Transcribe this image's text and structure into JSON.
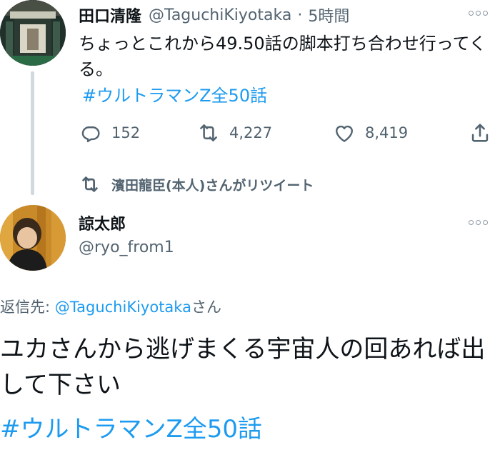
{
  "tweet1": {
    "author_name": "田口清隆",
    "author_handle": "@TaguchiKiyotaka",
    "separator": "·",
    "time": "5時間",
    "text": "ちょっとこれから49.50話の脚本打ち合わせ行ってくる。",
    "hashtag": "#ウルトラマンZ全50話",
    "reply_count": "152",
    "retweet_count": "4,227",
    "like_count": "8,419"
  },
  "retweet_note": {
    "label": "濱田龍臣(本人)さんがリツイート"
  },
  "tweet2": {
    "author_name": "諒太郎",
    "author_handle": "@ryo_from1",
    "reply_prefix": "返信先: ",
    "reply_mention": "@TaguchiKiyotaka",
    "reply_suffix": "さん",
    "text": "ユカさんから逃げまくる宇宙人の回あれば出して下さい",
    "hashtag": "#ウルトラマンZ全50話"
  },
  "colors": {
    "accent": "#1d9bf0",
    "secondary_text": "#536471",
    "primary_text": "#0f1419"
  },
  "icons": [
    "reply-icon",
    "retweet-icon",
    "like-icon",
    "share-icon",
    "more-icon"
  ]
}
